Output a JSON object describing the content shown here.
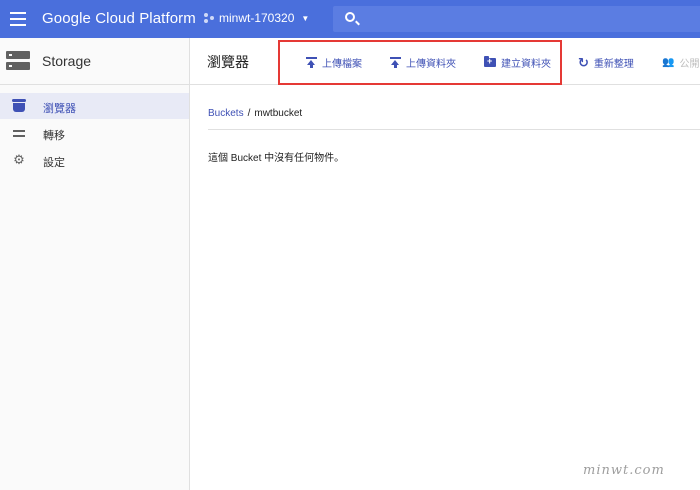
{
  "topbar": {
    "brand": "Google Cloud Platform",
    "project": "minwt-170320",
    "accent": "#4a6fdc"
  },
  "sidebar": {
    "title": "Storage",
    "items": [
      {
        "label": "瀏覽器",
        "icon": "bucket-icon",
        "active": true
      },
      {
        "label": "轉移",
        "icon": "transfer-icon",
        "active": false
      },
      {
        "label": "設定",
        "icon": "gear-icon",
        "active": false
      }
    ]
  },
  "toolbar": {
    "title": "瀏覽器",
    "upload_files": "上傳檔案",
    "upload_folder": "上傳資料夾",
    "create_folder": "建立資料夾",
    "refresh": "重新整理",
    "share_publicly": "公開共"
  },
  "breadcrumb": {
    "root": "Buckets",
    "separator": "/",
    "current": "mwtbucket"
  },
  "main": {
    "empty_message": "這個 Bucket 中沒有任何物件。"
  },
  "watermark": "minwt.com"
}
